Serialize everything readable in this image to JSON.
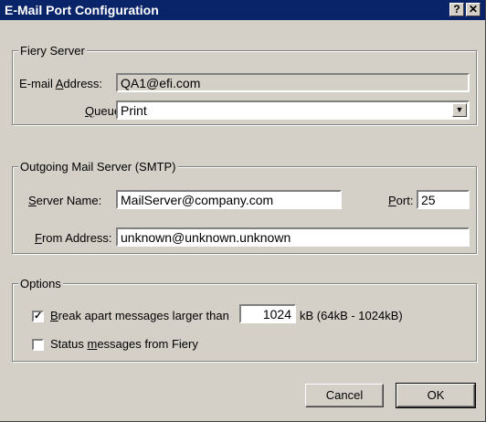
{
  "window": {
    "title": "E-Mail Port Configuration",
    "help_label": "?",
    "close_label": "✕"
  },
  "fiery_server": {
    "legend": "Fiery Server",
    "email_label_pre": "E-mail ",
    "email_label_key": "A",
    "email_label_post": "ddress:",
    "email_value": "QA1@efi.com",
    "queue_label_key": "Q",
    "queue_label_post": "ueue:",
    "queue_value": "Print"
  },
  "smtp": {
    "legend": "Outgoing Mail Server (SMTP)",
    "server_label_key": "S",
    "server_label_post": "erver Name:",
    "server_value": "MailServer@company.com",
    "port_label_key": "P",
    "port_label_post": "ort:",
    "port_value": "25",
    "from_label_key": "F",
    "from_label_post": "rom Address:",
    "from_value": "unknown@unknown.unknown"
  },
  "options": {
    "legend": "Options",
    "break_checked": true,
    "break_mark": "✓",
    "break_label_key": "B",
    "break_label_post": "reak apart messages larger than",
    "break_size": "1024",
    "break_range": "kB (64kB - 1024kB)",
    "status_checked": false,
    "status_label_pre": "Status ",
    "status_label_key": "m",
    "status_label_post": "essages from Fiery"
  },
  "buttons": {
    "cancel": "Cancel",
    "ok": "OK"
  },
  "icons": {
    "dropdown": "▼"
  }
}
